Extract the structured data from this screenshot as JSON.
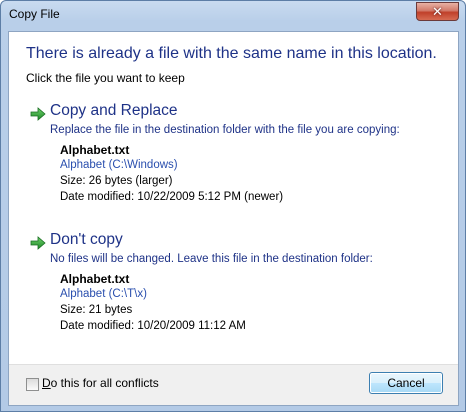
{
  "window": {
    "title": "Copy File",
    "close_symbol": "✕"
  },
  "header": {
    "main": "There is already a file with the same name in this location.",
    "sub": "Click the file you want to keep"
  },
  "options": [
    {
      "icon": "green-arrow-icon",
      "title": "Copy and Replace",
      "description": "Replace the file in the destination folder with the file you are copying:",
      "file_name": "Alphabet.txt",
      "location": "Alphabet (C:\\Windows)",
      "size": "Size: 26 bytes (larger)",
      "date": "Date modified: 10/22/2009 5:12 PM (newer)"
    },
    {
      "icon": "green-arrow-icon",
      "title": "Don't copy",
      "description": "No files will be changed. Leave this file in the destination folder:",
      "file_name": "Alphabet.txt",
      "location": "Alphabet (C:\\T\\x)",
      "size": "Size: 21 bytes",
      "date": "Date modified: 10/20/2009 11:12 AM"
    }
  ],
  "footer": {
    "checkbox_access_key": "D",
    "checkbox_label_rest": "o this for all conflicts",
    "checkbox_checked": false,
    "cancel_label": "Cancel"
  },
  "colors": {
    "heading_blue": "#1e3287",
    "link_blue": "#2a4fae",
    "arrow_green": "#2fa33a"
  }
}
